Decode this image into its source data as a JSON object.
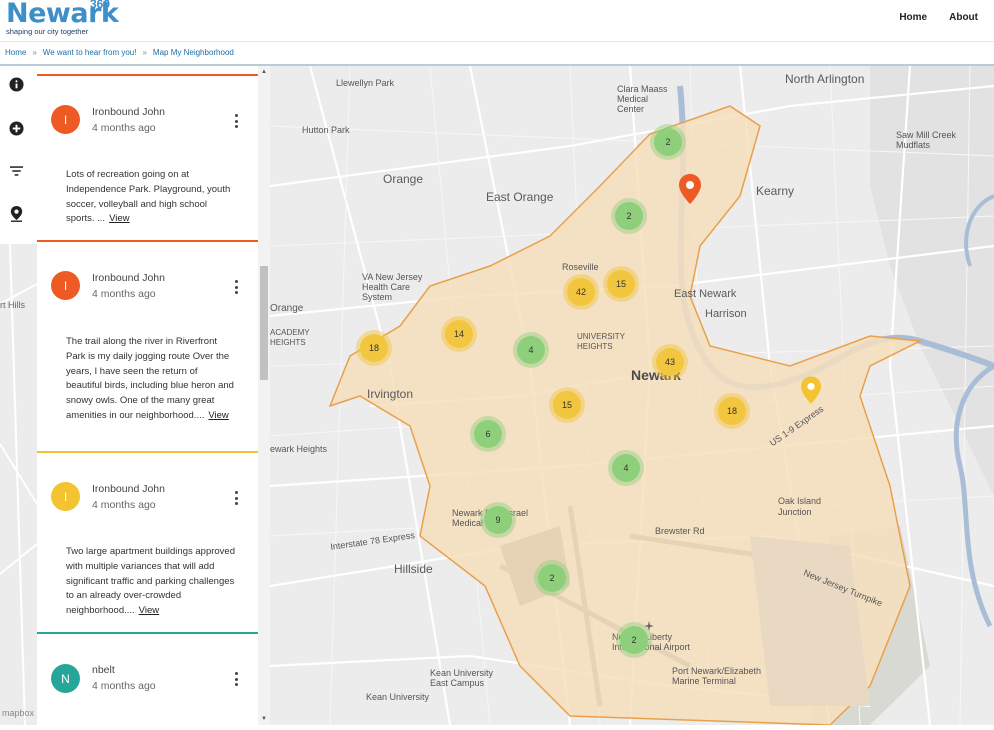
{
  "header": {
    "logo_text": "Newark",
    "logo_sup": "360",
    "logo_tagline": "shaping our city together",
    "nav": [
      "Home",
      "About"
    ]
  },
  "breadcrumb": {
    "items": [
      "Home",
      "We want to hear from you!",
      "Map My Neighborhood"
    ],
    "separator": "»"
  },
  "tools": [
    {
      "icon": "info-icon"
    },
    {
      "icon": "add-icon"
    },
    {
      "icon": "filter-icon"
    },
    {
      "icon": "location-pin-icon"
    }
  ],
  "posts": [
    {
      "initial": "I",
      "user": "Ironbound John",
      "time": "4 months ago",
      "color": "#ee5a24",
      "text": "Lots of recreation going on at Independence Park.  Playground, youth soccer, volleyball and high school sports.  ...",
      "view": "View"
    },
    {
      "initial": "I",
      "user": "Ironbound John",
      "time": "4 months ago",
      "color": "#ee5a24",
      "text": "The trail along the river in Riverfront Park is my daily jogging route  Over the years, I have seen the return of beautiful birds, including blue heron and snowy owls.  One of the many great amenities in our neighborhood....",
      "view": "View"
    },
    {
      "initial": "I",
      "user": "Ironbound John",
      "time": "4 months ago",
      "color": "#f4c430",
      "text": "Two large apartment buildings approved with multiple variances that will add significant traffic and parking challenges to an already over-crowded neighborhood....",
      "view": "View"
    },
    {
      "initial": "N",
      "user": "nbelt",
      "time": "4 months ago",
      "color": "#26a69a"
    }
  ],
  "map": {
    "labels": {
      "north_arlington": "North Arlington",
      "clara_maass": "Clara Maass Medical Center",
      "llewellyn": "Llewellyn Park",
      "hutton": "Hutton Park",
      "orange": "Orange",
      "east_orange": "East Orange",
      "kearny": "Kearny",
      "saw_mill": "Saw Mill Creek Mudflats",
      "va": "VA New Jersey Health Care System",
      "roseville": "Roseville",
      "east_newark": "East Newark",
      "harrison": "Harrison",
      "orange_sub": "Orange",
      "academy": "ACADEMY HEIGHTS",
      "univ_heights": "UNIVERSITY HEIGHTS",
      "newark": "Newark",
      "irvington": "Irvington",
      "ort_hills": "rt Hills",
      "newark_heights": "ewark Heights",
      "oak_island": "Oak Island Junction",
      "beth_israel": "Newark Beth Israel Medical Center",
      "hillside": "Hillside",
      "brewster": "Brewster Rd",
      "airport": "Newark Liberty International Airport",
      "port": "Port Newark/Elizabeth Marine Terminal",
      "kean": "Kean University East Campus",
      "kean2": "Kean University",
      "nj_turnpike": "New Jersey Turnpike",
      "interstate": "Interstate 78 Express",
      "us19": "US 1-9 Express"
    },
    "clusters": [
      {
        "count": "2",
        "color": "green"
      },
      {
        "count": "2",
        "color": "green"
      },
      {
        "count": "15",
        "color": "yellow"
      },
      {
        "count": "42",
        "color": "yellow"
      },
      {
        "count": "14",
        "color": "yellow"
      },
      {
        "count": "18",
        "color": "yellow"
      },
      {
        "count": "4",
        "color": "green"
      },
      {
        "count": "43",
        "color": "yellow"
      },
      {
        "count": "15",
        "color": "yellow"
      },
      {
        "count": "18",
        "color": "yellow"
      },
      {
        "count": "6",
        "color": "green"
      },
      {
        "count": "4",
        "color": "green"
      },
      {
        "count": "9",
        "color": "green"
      },
      {
        "count": "2",
        "color": "green"
      },
      {
        "count": "2",
        "color": "green"
      }
    ],
    "attribution": "mapbox"
  }
}
